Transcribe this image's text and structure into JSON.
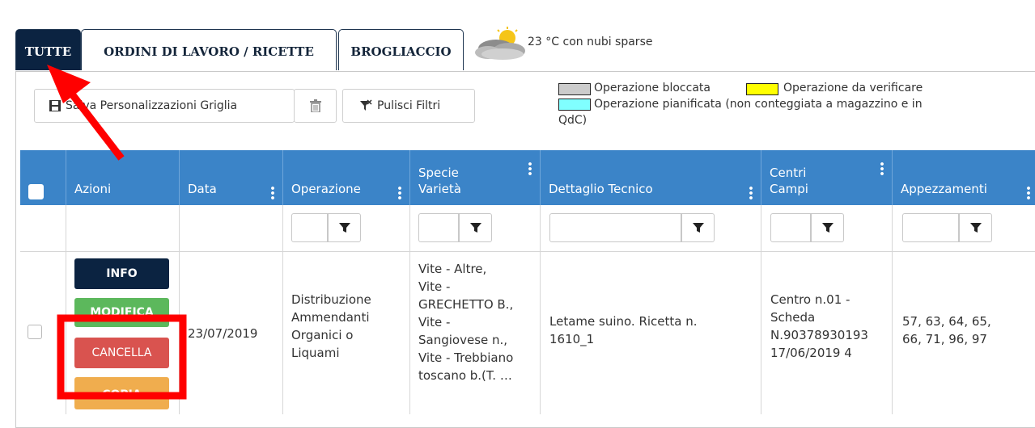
{
  "tabs": [
    {
      "label": "TUTTE"
    },
    {
      "label": "ORDINI DI LAVORO / RICETTE"
    },
    {
      "label": "BROGLIACCIO"
    }
  ],
  "weather": {
    "text": "23 °C con nubi sparse",
    "icon": "partly-cloudy-icon"
  },
  "toolbar": {
    "save_label": "Salva Personalizzazioni Griglia",
    "clear_filters_label": "Pulisci Filtri"
  },
  "legend": [
    {
      "color": "#cccccc",
      "label": "Operazione bloccata"
    },
    {
      "color": "#ffff00",
      "label": "Operazione da verificare"
    },
    {
      "color": "#80ffff",
      "label": "Operazione pianificata (non conteggiata a magazzino e in",
      "label_cont": "QdC)"
    }
  ],
  "grid": {
    "columns": [
      {
        "name": "Azioni"
      },
      {
        "name": "Data"
      },
      {
        "name": "Operazione"
      },
      {
        "line1": "Specie",
        "line2": "Varietà"
      },
      {
        "name": "Dettaglio Tecnico"
      },
      {
        "line1": "Centri",
        "line2": "Campi"
      },
      {
        "name": "Appezzamenti"
      }
    ],
    "row": {
      "actions": [
        "INFO",
        "MODIFICA",
        "CANCELLA",
        "COPIA"
      ],
      "data": "23/07/2019",
      "operazione": [
        "Distribuzione",
        "Ammendanti",
        "Organici o",
        "Liquami"
      ],
      "specie": [
        "Vite - Altre,",
        "Vite -",
        "GRECHETTO B.,",
        "Vite -",
        "Sangiovese n.,",
        "Vite - Trebbiano",
        "toscano b.(T. …"
      ],
      "dettaglio": [
        "Letame suino. Ricetta n.",
        "1610_1"
      ],
      "centri": [
        "Centro n.01 -",
        "Scheda",
        "N.90378930193",
        "17/06/2019 4"
      ],
      "appezzamenti": [
        "57, 63, 64, 65,",
        "66, 71, 96, 97"
      ]
    }
  },
  "colors": {
    "header_blue": "#3b84c8",
    "tab_active": "#0b2341",
    "info": "#0b2341",
    "modifica": "#5cb85c",
    "cancella": "#d9534f",
    "copia": "#f0ad4e",
    "annotation_red": "#ff0000"
  }
}
